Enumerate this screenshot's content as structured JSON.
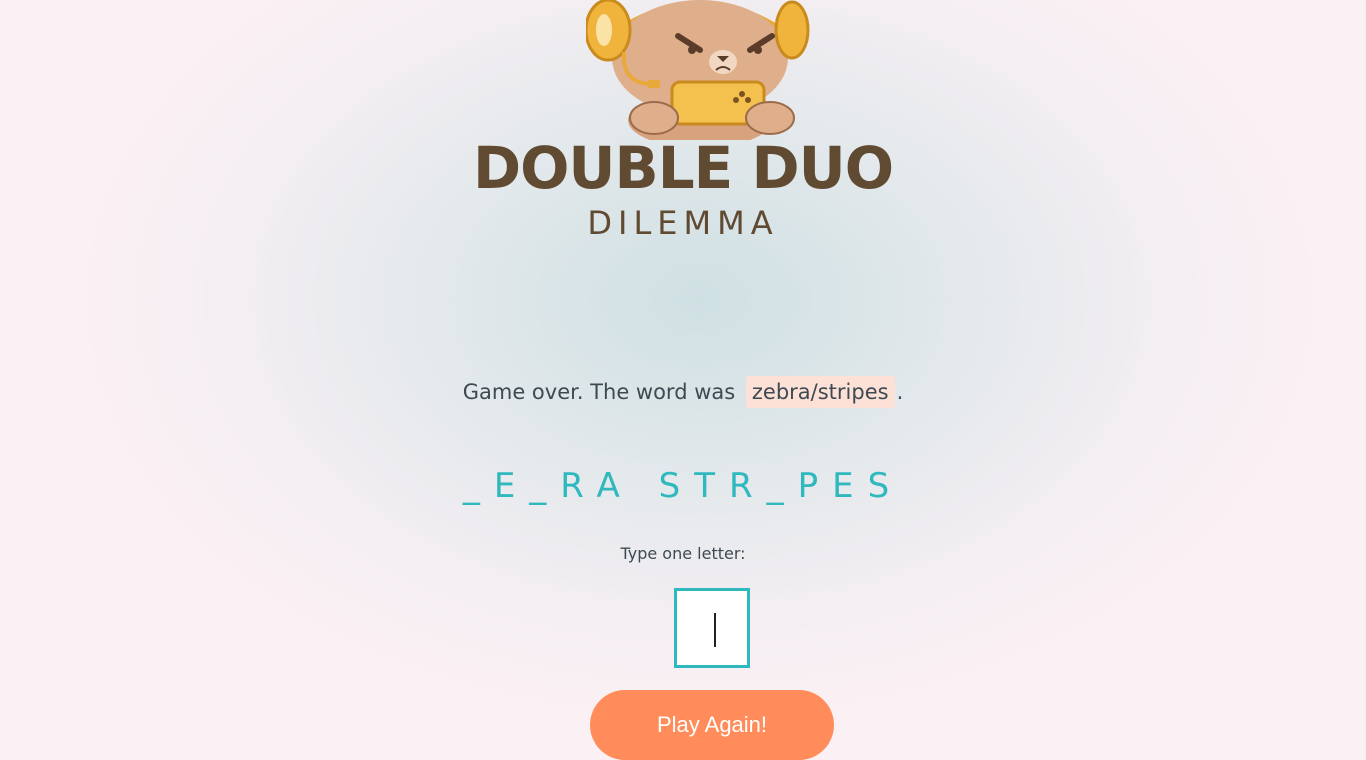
{
  "logo": {
    "title": "DOUBLE DUO",
    "subtitle": "DILEMMA",
    "mascot": "bear-gamer-icon"
  },
  "status": {
    "prefix": "Game over. The word was",
    "word": "zebra/stripes",
    "suffix": "."
  },
  "progress": "_E_RA STR_PES",
  "prompt": "Type one letter:",
  "input": {
    "value": ""
  },
  "button": {
    "label": "Play Again!"
  },
  "colors": {
    "accent": "#2fb8bd",
    "button": "#ff8c5a",
    "title": "#614a32",
    "highlight": "#fde0d6"
  }
}
